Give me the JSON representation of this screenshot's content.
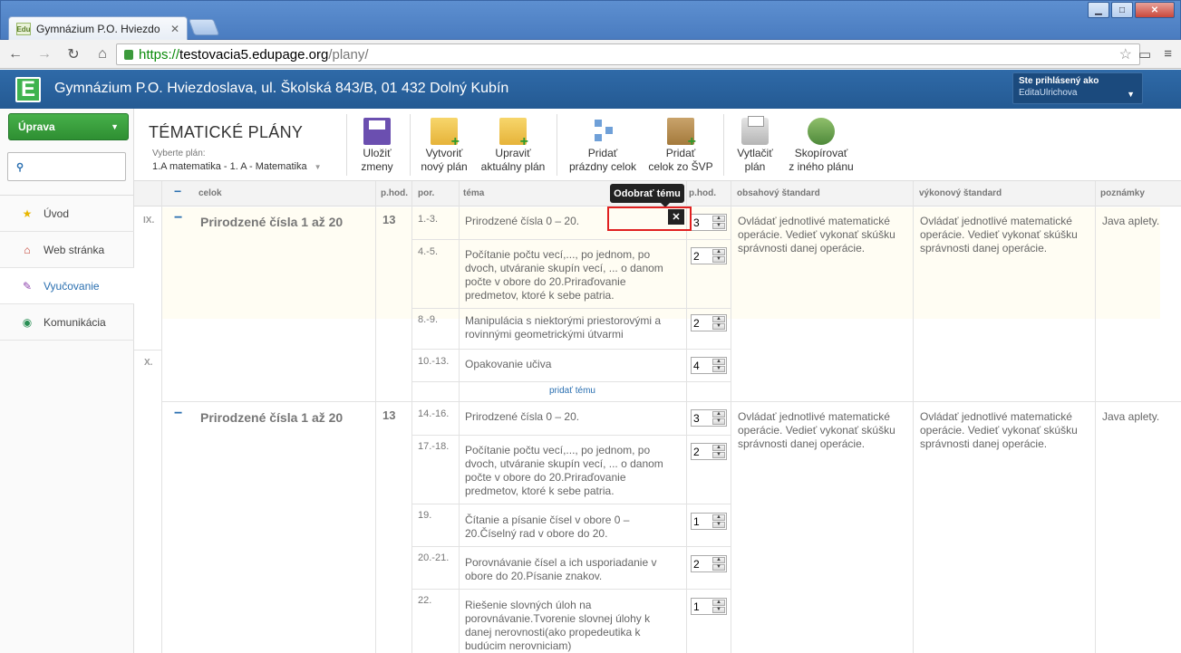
{
  "browser": {
    "tab_title": "Gymnázium P.O. Hviezdo",
    "tab_favicon_text": "Edu",
    "url_scheme": "https://",
    "url_host": "testovacia5.edupage.org",
    "url_path": "/plany/",
    "window_controls": [
      "minimize-icon",
      "maximize-icon",
      "close-icon"
    ]
  },
  "header": {
    "logo": "E",
    "school_name": "Gymnázium P.O. Hviezdoslava, ul. Školská 843/B, 01 432 Dolný Kubín",
    "logged_label": "Ste prihlásený ako",
    "username": "EditaUlrichova"
  },
  "sidebar": {
    "edit_button": "Úprava",
    "search_placeholder": "",
    "items": [
      {
        "label": "Úvod",
        "icon": "star-icon"
      },
      {
        "label": "Web stránka",
        "icon": "house-icon"
      },
      {
        "label": "Vyučovanie",
        "icon": "pen-icon"
      },
      {
        "label": "Komunikácia",
        "icon": "globe-icon"
      }
    ]
  },
  "pagebar": {
    "title": "TÉMATICKÉ PLÁNY",
    "select_label": "Vyberte plán:",
    "selected_plan": "1.A matematika - 1. A - Matematika",
    "buttons": [
      {
        "line1": "Uložiť",
        "line2": "zmeny"
      },
      {
        "line1": "Vytvoriť",
        "line2": "nový plán"
      },
      {
        "line1": "Upraviť",
        "line2": "aktuálny plán"
      },
      {
        "line1": "Pridať",
        "line2": "prázdny celok"
      },
      {
        "line1": "Pridať",
        "line2": "celok zo ŠVP"
      },
      {
        "line1": "Vytlačiť",
        "line2": "plán"
      },
      {
        "line1": "Skopírovať",
        "line2": "z iného plánu"
      }
    ]
  },
  "grid": {
    "headers": {
      "celok": "celok",
      "phod": "p.hod.",
      "por": "por.",
      "tema": "téma",
      "phod2": "p.hod.",
      "obsah": "obsahový štandard",
      "vykon": "výkonový štandard",
      "pozn": "poznámky"
    },
    "tooltip": "Odobrať tému",
    "add_topic": "pridať tému",
    "months": [
      "IX.",
      "X."
    ],
    "units": [
      {
        "name": "Prirodzené čísla 1 až 20",
        "hours": "13",
        "obsah": "Ovládať jednotlivé matematické operácie. Vedieť vykonať skúšku správnosti danej operácie.",
        "vykon": "Ovládať jednotlivé matematické operácie. Vedieť vykonať skúšku správnosti danej operácie.",
        "pozn": "Java aplety.",
        "topics": [
          {
            "por": "1.-3.",
            "tema": "Prirodzené čísla 0 – 20.",
            "hod": "3"
          },
          {
            "por": "4.-5.",
            "tema": "Počítanie počtu vecí,..., po jednom, po dvoch, utváranie skupín vecí, ... o danom počte v obore do 20.Priraďovanie predmetov, ktoré k sebe patria.",
            "hod": "2"
          },
          {
            "por": "8.-9.",
            "tema": "Manipulácia s niektorými priestorovými a rovinnými geometrickými útvarmi",
            "hod": "2"
          },
          {
            "por": "10.-13.",
            "tema": "Opakovanie učiva",
            "hod": "4"
          }
        ]
      },
      {
        "name": "Prirodzené čísla 1 až 20",
        "hours": "13",
        "obsah": "Ovládať jednotlivé matematické operácie. Vedieť vykonať skúšku správnosti danej operácie.",
        "vykon": "Ovládať jednotlivé matematické operácie. Vedieť vykonať skúšku správnosti danej operácie.",
        "pozn": "Java aplety.",
        "topics": [
          {
            "por": "14.-16.",
            "tema": "Prirodzené čísla 0 – 20.",
            "hod": "3"
          },
          {
            "por": "17.-18.",
            "tema": "Počítanie počtu vecí,..., po jednom, po dvoch, utváranie skupín vecí, ... o danom počte v obore do 20.Priraďovanie predmetov, ktoré k sebe patria.",
            "hod": "2"
          },
          {
            "por": "19.",
            "tema": "Čítanie a písanie čísel v obore 0 – 20.Číselný rad v obore do 20.",
            "hod": "1"
          },
          {
            "por": "20.-21.",
            "tema": "Porovnávanie čísel a ich usporiadanie v obore do 20.Písanie znakov.",
            "hod": "2"
          },
          {
            "por": "22.",
            "tema": "Riešenie slovných úloh na porovnávanie.Tvorenie slovnej úlohy k danej nerovnosti(ako propedeutika k budúcim nerovniciam)",
            "hod": "1"
          }
        ]
      }
    ]
  }
}
